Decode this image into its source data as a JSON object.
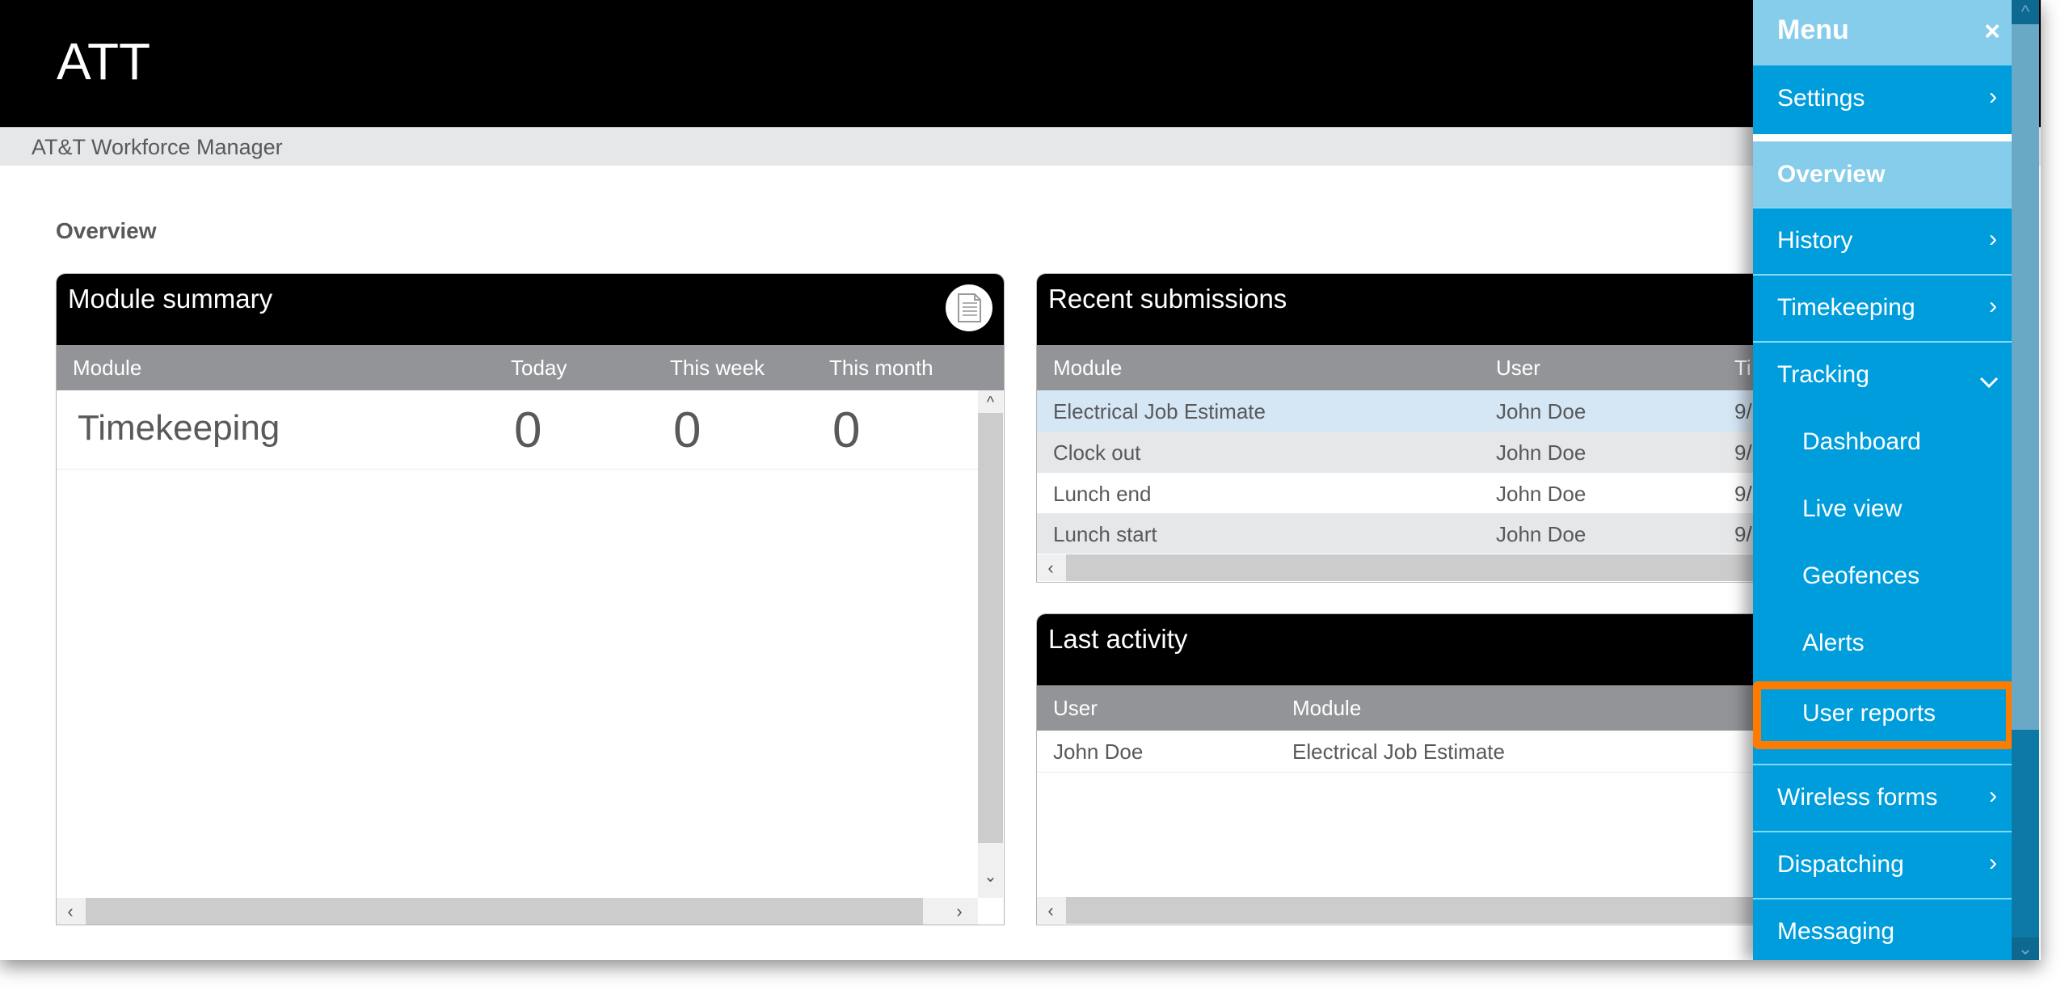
{
  "header": {
    "brand": "ATT",
    "subtitle": "AT&T Workforce Manager"
  },
  "page": {
    "heading": "Overview"
  },
  "module_summary": {
    "title": "Module summary",
    "export_icon": "document-icon",
    "columns": [
      "Module",
      "Today",
      "This week",
      "This month"
    ],
    "rows": [
      {
        "module": "Timekeeping",
        "today": "0",
        "this_week": "0",
        "this_month": "0"
      }
    ]
  },
  "recent_submissions": {
    "title": "Recent submissions",
    "columns": [
      "Module",
      "User",
      "Ti"
    ],
    "rows": [
      {
        "module": "Electrical Job Estimate",
        "user": "John Doe",
        "time": "9/"
      },
      {
        "module": "Clock out",
        "user": "John Doe",
        "time": "9/"
      },
      {
        "module": "Lunch end",
        "user": "John Doe",
        "time": "9/"
      },
      {
        "module": "Lunch start",
        "user": "John Doe",
        "time": "9/"
      }
    ]
  },
  "last_activity": {
    "title": "Last activity",
    "columns": [
      "User",
      "Module"
    ],
    "rows": [
      {
        "user": "John Doe",
        "module": "Electrical Job Estimate"
      }
    ]
  },
  "menu": {
    "title": "Menu",
    "close_icon": "×",
    "items": [
      {
        "label": "Settings",
        "chevron": "right"
      },
      {
        "label": "Overview",
        "active": true
      },
      {
        "label": "History",
        "chevron": "right"
      },
      {
        "label": "Timekeeping",
        "chevron": "right"
      },
      {
        "label": "Tracking",
        "chevron": "down",
        "expanded": true
      },
      {
        "label": "Dashboard",
        "sub": true
      },
      {
        "label": "Live view",
        "sub": true
      },
      {
        "label": "Geofences",
        "sub": true
      },
      {
        "label": "Alerts",
        "sub": true
      },
      {
        "label": "User reports",
        "sub": true,
        "highlighted": true
      },
      {
        "label": "Wireless forms",
        "chevron": "right"
      },
      {
        "label": "Dispatching",
        "chevron": "right"
      },
      {
        "label": "Messaging"
      }
    ]
  },
  "colors": {
    "menu_bg": "#009ddc",
    "menu_active": "#86cdeb",
    "highlight": "#ff7b00",
    "table_header": "#929497",
    "selected_row": "#d5e6f5"
  }
}
